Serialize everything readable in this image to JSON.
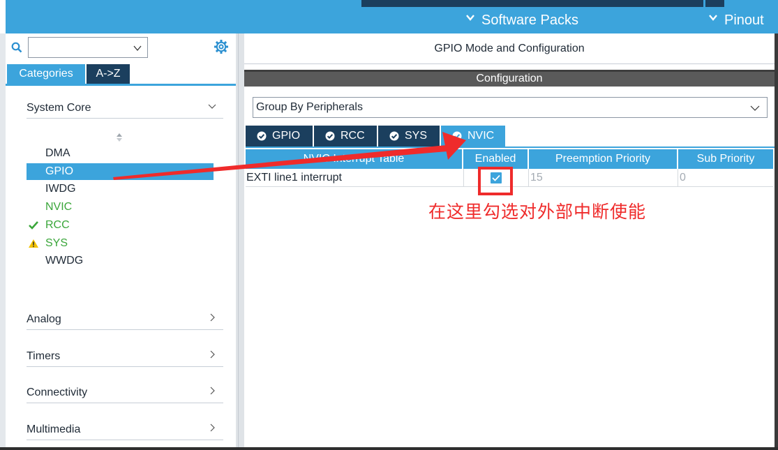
{
  "topbar": {
    "software_packs": "Software Packs",
    "pinout": "Pinout"
  },
  "left": {
    "search_value": "",
    "tabs": {
      "categories": "Categories",
      "az": "A->Z"
    },
    "sections": {
      "system_core": "System Core",
      "analog": "Analog",
      "timers": "Timers",
      "connectivity": "Connectivity",
      "multimedia": "Multimedia"
    },
    "peripherals": {
      "dma": "DMA",
      "gpio": "GPIO",
      "iwdg": "IWDG",
      "nvic": "NVIC",
      "rcc": "RCC",
      "sys": "SYS",
      "wwdg": "WWDG"
    }
  },
  "right": {
    "mode_title": "GPIO Mode and Configuration",
    "config_title": "Configuration",
    "group_select": "Group By Peripherals",
    "tabs": {
      "gpio": "GPIO",
      "rcc": "RCC",
      "sys": "SYS",
      "nvic": "NVIC"
    },
    "table": {
      "headers": {
        "name": "NVIC Interrupt Table",
        "enabled": "Enabled",
        "preemption": "Preemption Priority",
        "sub": "Sub Priority"
      },
      "rows": [
        {
          "name": "EXTI line1 interrupt",
          "enabled": true,
          "preemption": "15",
          "sub": "0"
        }
      ]
    }
  },
  "annotation": {
    "text": "在这里勾选对外部中断使能",
    "color": "#ef2b2b"
  },
  "colors": {
    "accent": "#3ca4dc",
    "dark_tab": "#1b3f5e",
    "ok_green": "#3aa63a",
    "warn_yellow": "#f2c200"
  },
  "icons": {
    "search": "search-icon",
    "settings": "gear-icon",
    "status_ok": "checkmark-icon",
    "status_warn": "warning-icon"
  }
}
